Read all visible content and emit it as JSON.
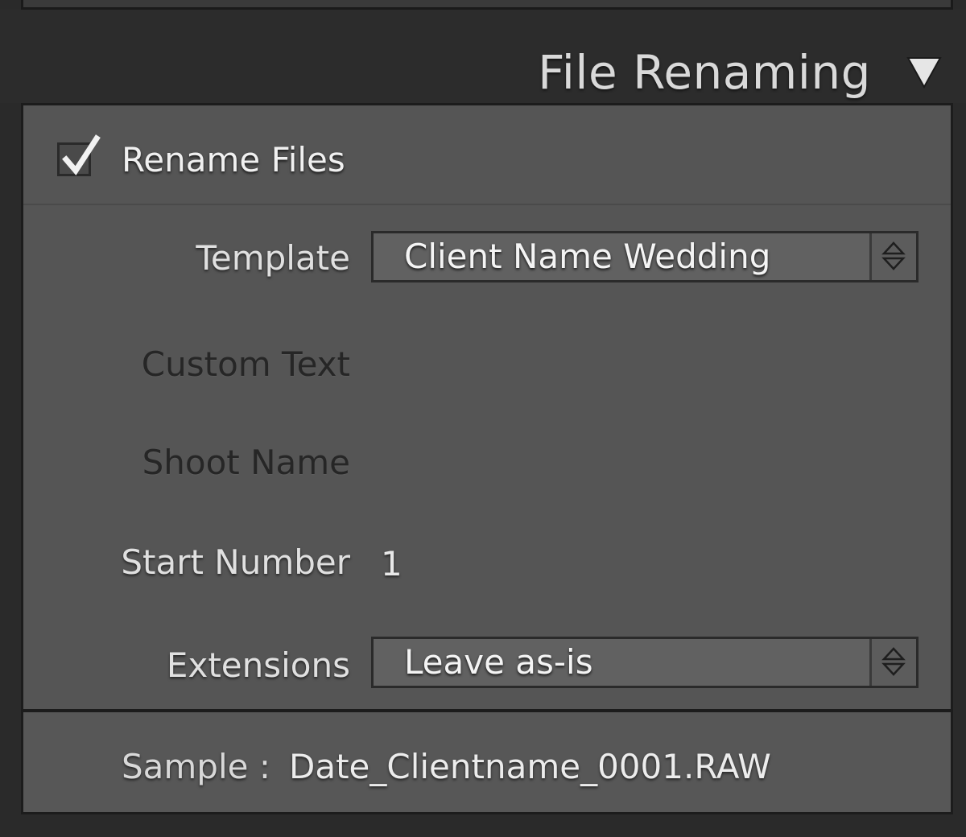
{
  "section": {
    "title": "File Renaming",
    "collapse_icon": "triangle-down-icon"
  },
  "rename_files": {
    "label": "Rename Files",
    "checked": true
  },
  "fields": {
    "template_label": "Template",
    "template_value": "Client Name Wedding",
    "custom_text_label": "Custom Text",
    "shoot_name_label": "Shoot Name",
    "start_number_label": "Start Number",
    "start_number_value": "1",
    "extensions_label": "Extensions",
    "extensions_value": "Leave as-is"
  },
  "sample": {
    "label": "Sample :",
    "value": "Date_Clientname_0001.RAW"
  },
  "colors": {
    "panel_bg": "#555555",
    "header_bg": "#2c2c2c",
    "text": "#e0e0e0"
  }
}
